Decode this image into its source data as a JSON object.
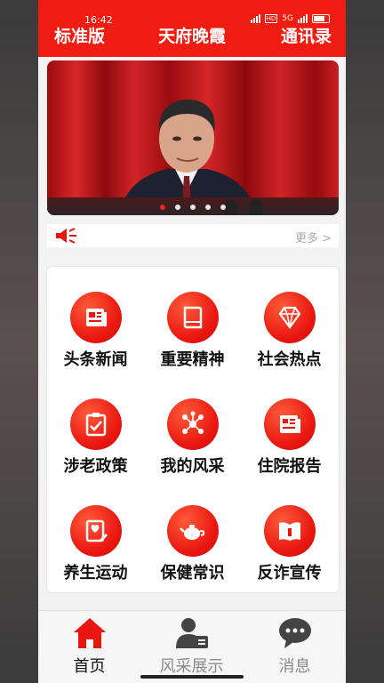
{
  "status": {
    "time": "16:42",
    "signal_left": "5G",
    "hd": "HD",
    "signal_right": "5G"
  },
  "header": {
    "left": "标准版",
    "title": "天府晚霞",
    "right": "通讯录"
  },
  "banner": {
    "image": "photo-speaker-red-curtain",
    "pages": 5,
    "active_page": 1
  },
  "notice": {
    "more": "更多 >"
  },
  "grid": [
    {
      "label": "头条新闻",
      "icon": "newspaper-icon"
    },
    {
      "label": "重要精神",
      "icon": "book-icon"
    },
    {
      "label": "社会热点",
      "icon": "diamond-icon"
    },
    {
      "label": "涉老政策",
      "icon": "clipboard-check-icon"
    },
    {
      "label": "我的风采",
      "icon": "share-nodes-icon"
    },
    {
      "label": "住院报告",
      "icon": "report-icon"
    },
    {
      "label": "养生运动",
      "icon": "heart-pen-icon"
    },
    {
      "label": "保健常识",
      "icon": "teapot-icon"
    },
    {
      "label": "反诈宣传",
      "icon": "open-book-icon"
    }
  ],
  "nav": [
    {
      "label": "首页",
      "icon": "home-icon",
      "active": true
    },
    {
      "label": "风采展示",
      "icon": "user-card-icon",
      "active": false
    },
    {
      "label": "消息",
      "icon": "chat-bubble-icon",
      "active": false
    }
  ],
  "colors": {
    "brand": "#ef1c12",
    "nav_active": "#e8160f",
    "nav_inactive": "#8a8a8a"
  }
}
